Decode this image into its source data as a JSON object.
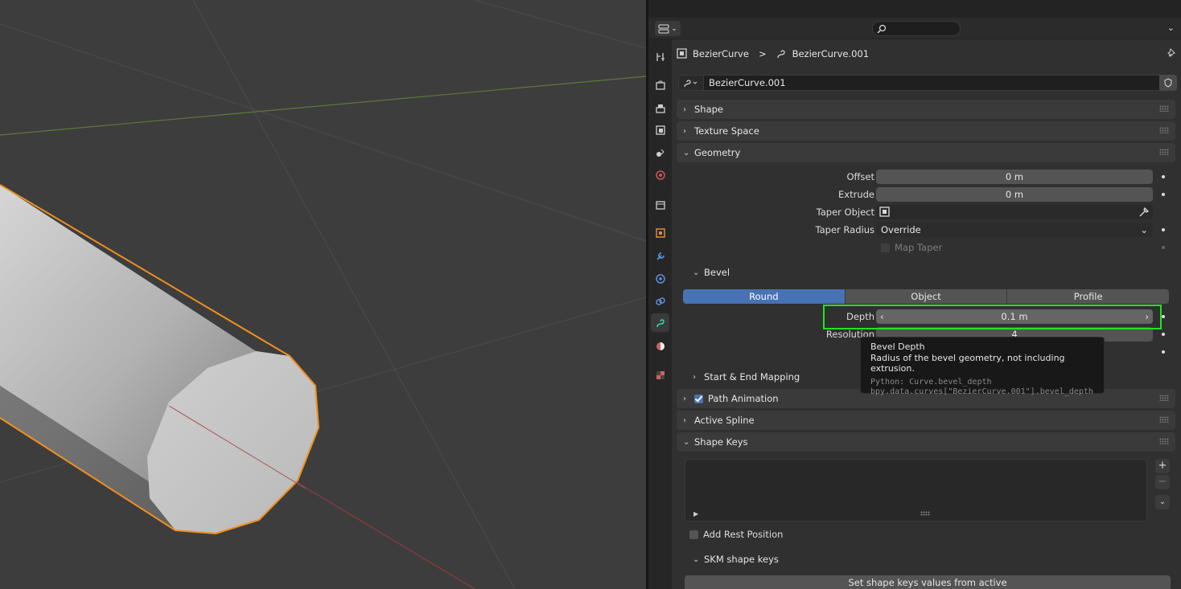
{
  "breadcrumb": {
    "object": "BezierCurve",
    "separator": ">",
    "data": "BezierCurve.001"
  },
  "datablock": {
    "name": "BezierCurve.001"
  },
  "panels": {
    "shape": "Shape",
    "texture_space": "Texture Space",
    "geometry": "Geometry",
    "path_animation": "Path Animation",
    "active_spline": "Active Spline",
    "shape_keys": "Shape Keys"
  },
  "geometry": {
    "offset_label": "Offset",
    "offset_value": "0 m",
    "extrude_label": "Extrude",
    "extrude_value": "0 m",
    "taper_object_label": "Taper Object",
    "taper_radius_label": "Taper Radius",
    "taper_radius_value": "Override",
    "map_taper_label": "Map Taper"
  },
  "bevel": {
    "heading": "Bevel",
    "tabs": [
      "Round",
      "Object",
      "Profile"
    ],
    "active_tab": "Round",
    "depth_label": "Depth",
    "depth_value": "0.1 m",
    "resolution_label": "Resolution",
    "resolution_value": "4"
  },
  "start_end_mapping": "Start & End Mapping",
  "tooltip": {
    "title": "Bevel Depth",
    "description": "Radius of the bevel geometry, not including extrusion.",
    "python1": "Python: Curve.bevel_depth",
    "python2": "bpy.data.curves[\"BezierCurve.001\"].bevel_depth"
  },
  "shape_keys": {
    "add_rest_position": "Add Rest Position",
    "skm_heading": "SKM shape keys",
    "set_button": "Set shape keys values from active"
  },
  "colors": {
    "accent": "#4772b3",
    "highlight": "#22e322",
    "selection_outline": "#f0901e"
  }
}
